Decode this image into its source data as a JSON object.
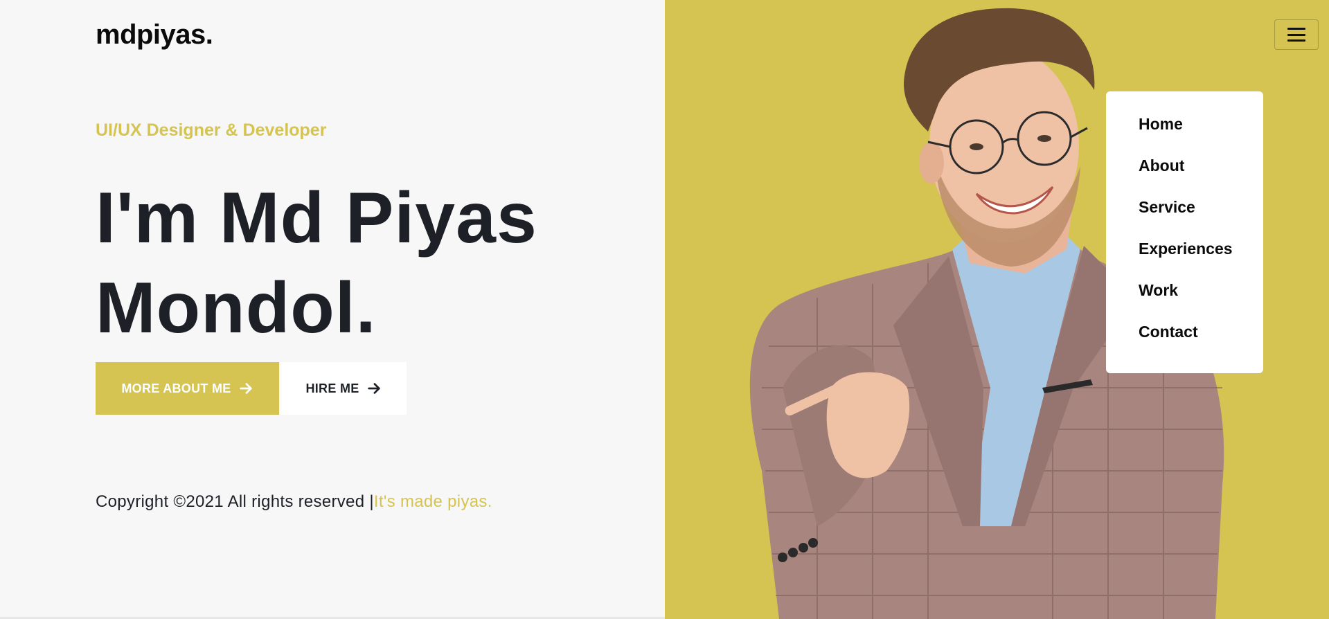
{
  "brand": {
    "logo": "mdpiyas."
  },
  "hero": {
    "subtitle": "UI/UX Designer & Developer",
    "headline_line1": "I'm Md Piyas",
    "headline_line2": "Mondol.",
    "primary_button": "MORE ABOUT ME",
    "secondary_button": "HIRE ME"
  },
  "footer": {
    "copyright": "Copyright ©2021 All rights reserved |",
    "credit": "It's made piyas."
  },
  "nav": {
    "menu_icon": "hamburger-icon",
    "items": [
      {
        "label": "Home"
      },
      {
        "label": "About"
      },
      {
        "label": "Service"
      },
      {
        "label": "Experiences"
      },
      {
        "label": "Work"
      },
      {
        "label": "Contact"
      }
    ]
  },
  "colors": {
    "accent": "#d5c352",
    "dark": "#1d2127",
    "background": "#f7f7f7"
  }
}
